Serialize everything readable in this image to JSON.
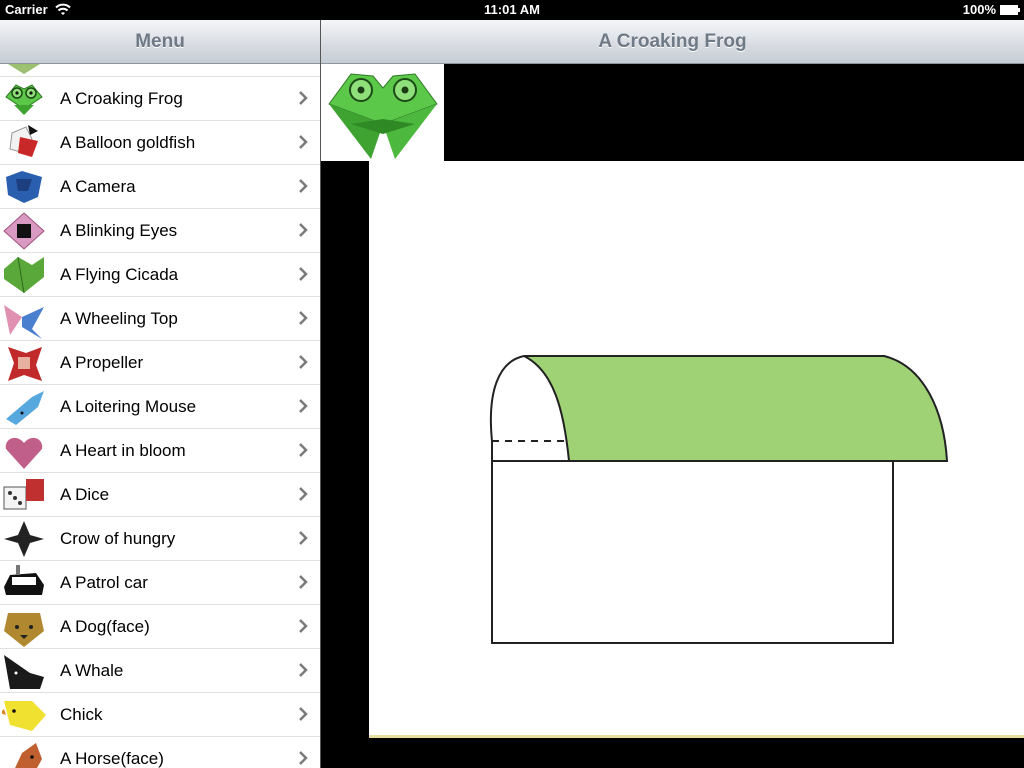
{
  "status_bar": {
    "carrier": "Carrier",
    "time": "11:01 AM",
    "battery": "100%"
  },
  "menu": {
    "title": "Menu",
    "items": [
      {
        "label": "A Croaking Frog",
        "icon": "frog-icon",
        "color": "#5cc84a"
      },
      {
        "label": "A Balloon goldfish",
        "icon": "goldfish-icon",
        "color": "#c82828"
      },
      {
        "label": "A Camera",
        "icon": "camera-icon",
        "color": "#2a5fb0"
      },
      {
        "label": "A Blinking Eyes",
        "icon": "eyes-icon",
        "color": "#d89ac0"
      },
      {
        "label": "A Flying Cicada",
        "icon": "cicada-icon",
        "color": "#5aa83a"
      },
      {
        "label": "A Wheeling Top",
        "icon": "top-icon",
        "color": "#4a7fd0"
      },
      {
        "label": "A Propeller",
        "icon": "propeller-icon",
        "color": "#c02a2a"
      },
      {
        "label": "A Loitering Mouse",
        "icon": "mouse-icon",
        "color": "#58a8e0"
      },
      {
        "label": "A Heart in bloom",
        "icon": "heart-icon",
        "color": "#c0608a"
      },
      {
        "label": "A Dice",
        "icon": "dice-icon",
        "color": "#c03030"
      },
      {
        "label": "Crow of hungry",
        "icon": "crow-icon",
        "color": "#222222"
      },
      {
        "label": "A Patrol car",
        "icon": "patrol-car-icon",
        "color": "#111111"
      },
      {
        "label": "A Dog(face)",
        "icon": "dog-face-icon",
        "color": "#b08830"
      },
      {
        "label": "A Whale",
        "icon": "whale-icon",
        "color": "#1a1a1a"
      },
      {
        "label": "Chick",
        "icon": "chick-icon",
        "color": "#f0e030"
      },
      {
        "label": "A Horse(face)",
        "icon": "horse-face-icon",
        "color": "#c06030"
      }
    ]
  },
  "detail": {
    "title": "A Croaking Frog",
    "thumb_icon": "frog-icon",
    "diagram_fill": "#9ed275"
  }
}
